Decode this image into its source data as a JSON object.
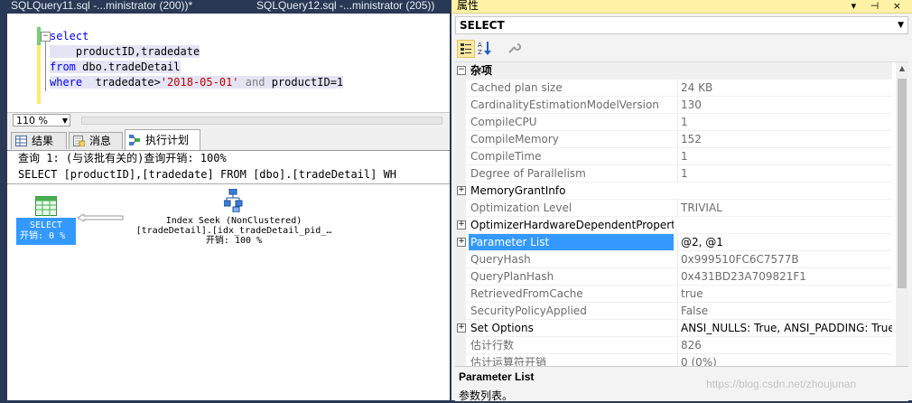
{
  "doc_tabs": {
    "active": "SQLQuery11.sql -...ministrator (200))*",
    "inactive": "SQLQuery12.sql -...ministrator (205))"
  },
  "editor": {
    "line1_kw": "select",
    "line2": "productID,tradedate",
    "line3_kw": "from",
    "line3_rest": "dbo.tradeDetail",
    "line4_kw": "where",
    "line4_col": "tradedate>",
    "line4_str": "'2018-05-01'",
    "line4_and": "and",
    "line4_rest": "productID=1"
  },
  "zoom": {
    "value": "110 %"
  },
  "result_tabs": [
    {
      "label": "结果"
    },
    {
      "label": "消息"
    },
    {
      "label": "执行计划"
    }
  ],
  "plan": {
    "query_title": "查询 1: (与该批有关的)查询开销: 100%",
    "query_sql": "SELECT [productID],[tradedate] FROM [dbo].[tradeDetail] WH",
    "select_node": {
      "label": "SELECT",
      "cost": "开销: 0 %"
    },
    "seek_node": {
      "line1": "Index Seek (NonClustered)",
      "line2": "[tradeDetail].[idx_tradeDetail_pid_…",
      "line3": "开销: 100 %"
    }
  },
  "properties": {
    "title": "属性",
    "window_buttons": "▾ ⊣ ×",
    "object": "SELECT",
    "category": "杂项",
    "rows": [
      {
        "name": "Cached plan size",
        "value": "24 KB"
      },
      {
        "name": "CardinalityEstimationModelVersion",
        "value": "130"
      },
      {
        "name": "CompileCPU",
        "value": "1"
      },
      {
        "name": "CompileMemory",
        "value": "152"
      },
      {
        "name": "CompileTime",
        "value": "1"
      },
      {
        "name": "Degree of Parallelism",
        "value": "1"
      },
      {
        "name": "MemoryGrantInfo",
        "value": ""
      },
      {
        "name": "Optimization Level",
        "value": "TRIVIAL"
      },
      {
        "name": "OptimizerHardwareDependentProperti",
        "value": ""
      },
      {
        "name": "Parameter List",
        "value": "@2, @1"
      },
      {
        "name": "QueryHash",
        "value": "0x999510FC6C7577B"
      },
      {
        "name": "QueryPlanHash",
        "value": "0x431BD23A709821F1"
      },
      {
        "name": "RetrievedFromCache",
        "value": "true"
      },
      {
        "name": "SecurityPolicyApplied",
        "value": "False"
      },
      {
        "name": "Set Options",
        "value": "ANSI_NULLS: True, ANSI_PADDING: True,"
      },
      {
        "name": "估计行数",
        "value": "826"
      },
      {
        "name": "估计运算符开销",
        "value": "0 (0%)"
      }
    ],
    "description_title": "Parameter List",
    "description_text": "参数列表。"
  },
  "watermark": "https://blog.csdn.net/zhoujunan"
}
